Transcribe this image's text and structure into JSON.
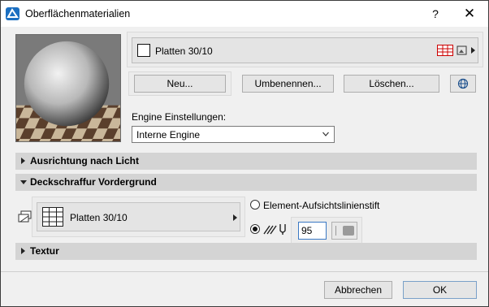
{
  "window": {
    "title": "Oberflächenmaterialien",
    "help_label": "?",
    "close_label": "✕"
  },
  "material": {
    "name": "Platten 30/10"
  },
  "buttons": {
    "new": "Neu...",
    "rename": "Umbenennen...",
    "delete": "Löschen...",
    "cancel": "Abbrechen",
    "ok": "OK"
  },
  "engine": {
    "label": "Engine Einstellungen:",
    "value": "Interne Engine"
  },
  "sections": {
    "light": "Ausrichtung nach Licht",
    "foreground": "Deckschraffur Vordergrund",
    "texture": "Textur"
  },
  "foreground": {
    "fill_name": "Platten 30/10",
    "option_pen": "Element-Aufsichtslinienstift",
    "pen_number": "95"
  },
  "colors": {
    "section_bg": "#d4d4d4",
    "accent": "#3a78c4",
    "grid_icon": "#cc0000"
  },
  "icons": [
    "app-icon",
    "help-icon",
    "close-icon",
    "red-grid-icon",
    "cube-photo-icon",
    "globe-icon",
    "fill-pattern-icon",
    "layer-stack-icon",
    "hatch-pen-icon"
  ]
}
